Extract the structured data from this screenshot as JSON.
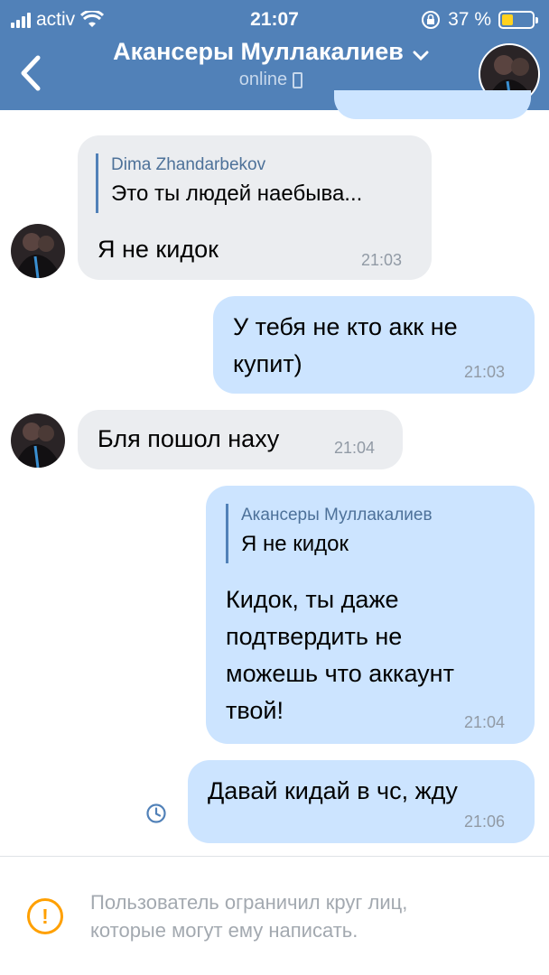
{
  "status_bar": {
    "carrier": "activ",
    "time": "21:07",
    "battery_percent": "37 %",
    "battery_level": 0.37,
    "battery_color": "#ffd21f"
  },
  "header": {
    "contact_name": "Акансеры Муллакалиев",
    "status": "online",
    "back_icon": "chevron-left-icon",
    "dropdown_icon": "chevron-down-icon",
    "device_icon": "phone-icon",
    "bg_color": "#5181b8"
  },
  "messages": [
    {
      "direction": "in",
      "quote": {
        "author": "Dima Zhandarbekov",
        "text": "Это ты людей наебыва..."
      },
      "text": "Я не кидок",
      "time": "21:03"
    },
    {
      "direction": "out",
      "text_lines": [
        "У тебя не кто акк не",
        "купит)"
      ],
      "time": "21:03"
    },
    {
      "direction": "in",
      "text": "Бля пошол наху",
      "time": "21:04"
    },
    {
      "direction": "out",
      "quote": {
        "author": "Акансеры Муллакалиев",
        "text": "Я не кидок"
      },
      "text_lines": [
        "Кидок, ты даже",
        "подтвердить не",
        "можешь что аккаунт",
        "твой!"
      ],
      "time": "21:04"
    },
    {
      "direction": "out",
      "text": "Давай кидай в чс, жду",
      "time": "21:06",
      "status_icon": "clock-icon"
    }
  ],
  "footer": {
    "warning_icon": "exclamation-icon",
    "notice_lines": [
      "Пользователь ограничил круг лиц,",
      "которые могут ему написать."
    ]
  }
}
